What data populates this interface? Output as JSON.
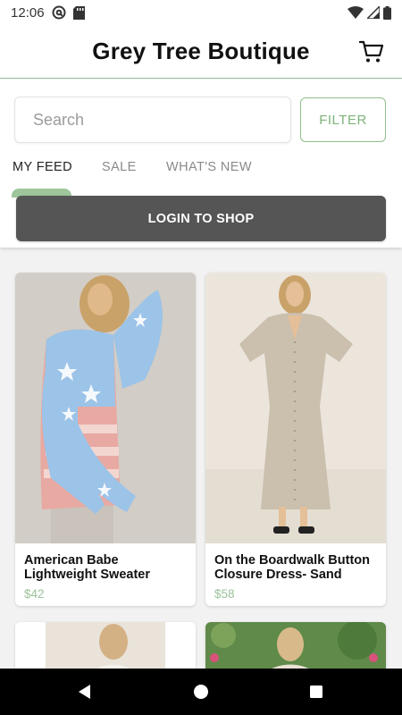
{
  "status_bar": {
    "time": "12:06",
    "icons": [
      "at-sign-icon",
      "sd-card-icon",
      "wifi-icon",
      "signal-icon",
      "battery-icon"
    ]
  },
  "header": {
    "title": "Grey Tree Boutique",
    "cart_icon": "cart-icon"
  },
  "search": {
    "placeholder": "Search",
    "value": ""
  },
  "filter_label": "FILTER",
  "tabs": [
    {
      "label": "MY FEED",
      "active": true
    },
    {
      "label": "SALE",
      "active": false
    },
    {
      "label": "WHAT'S NEW",
      "active": false
    }
  ],
  "login_label": "LOGIN TO SHOP",
  "products": [
    {
      "name": "American Babe Lightweight Sweater",
      "price": "$42"
    },
    {
      "name": "On the Boardwalk Button Closure Dress- Sand",
      "price": "$58"
    }
  ],
  "nav": {
    "icons": [
      "back-icon",
      "home-icon",
      "recents-icon"
    ]
  },
  "colors": {
    "accent_green": "#9cc29a",
    "filter_green": "#7db37a",
    "login_bg": "#555555"
  }
}
